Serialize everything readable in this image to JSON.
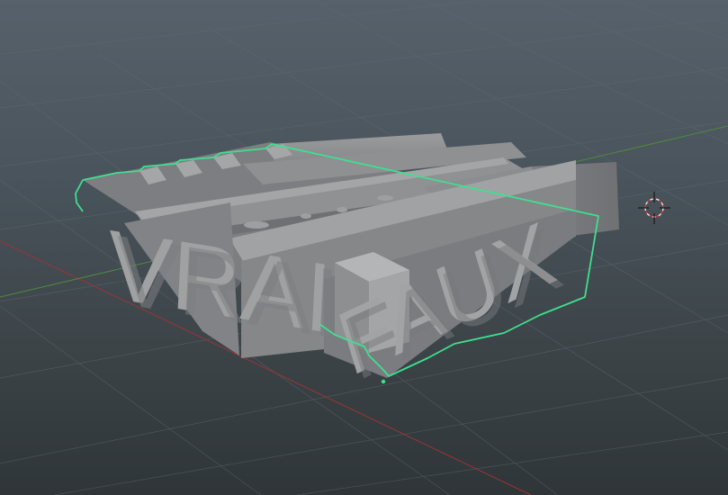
{
  "app": {
    "view": "3d-viewport"
  },
  "scene": {
    "model_labels": {
      "left": "VRAI",
      "right": "FAUX"
    },
    "selection_color": "#3ee08f",
    "x_axis_color": "#9a3434",
    "y_axis_color": "#4f8a3c",
    "grid_color": "#5f6a73",
    "model_color": "#8a8c8e"
  },
  "icons": {
    "cursor": "3d-cursor-icon",
    "origin": "object-origin-icon"
  }
}
